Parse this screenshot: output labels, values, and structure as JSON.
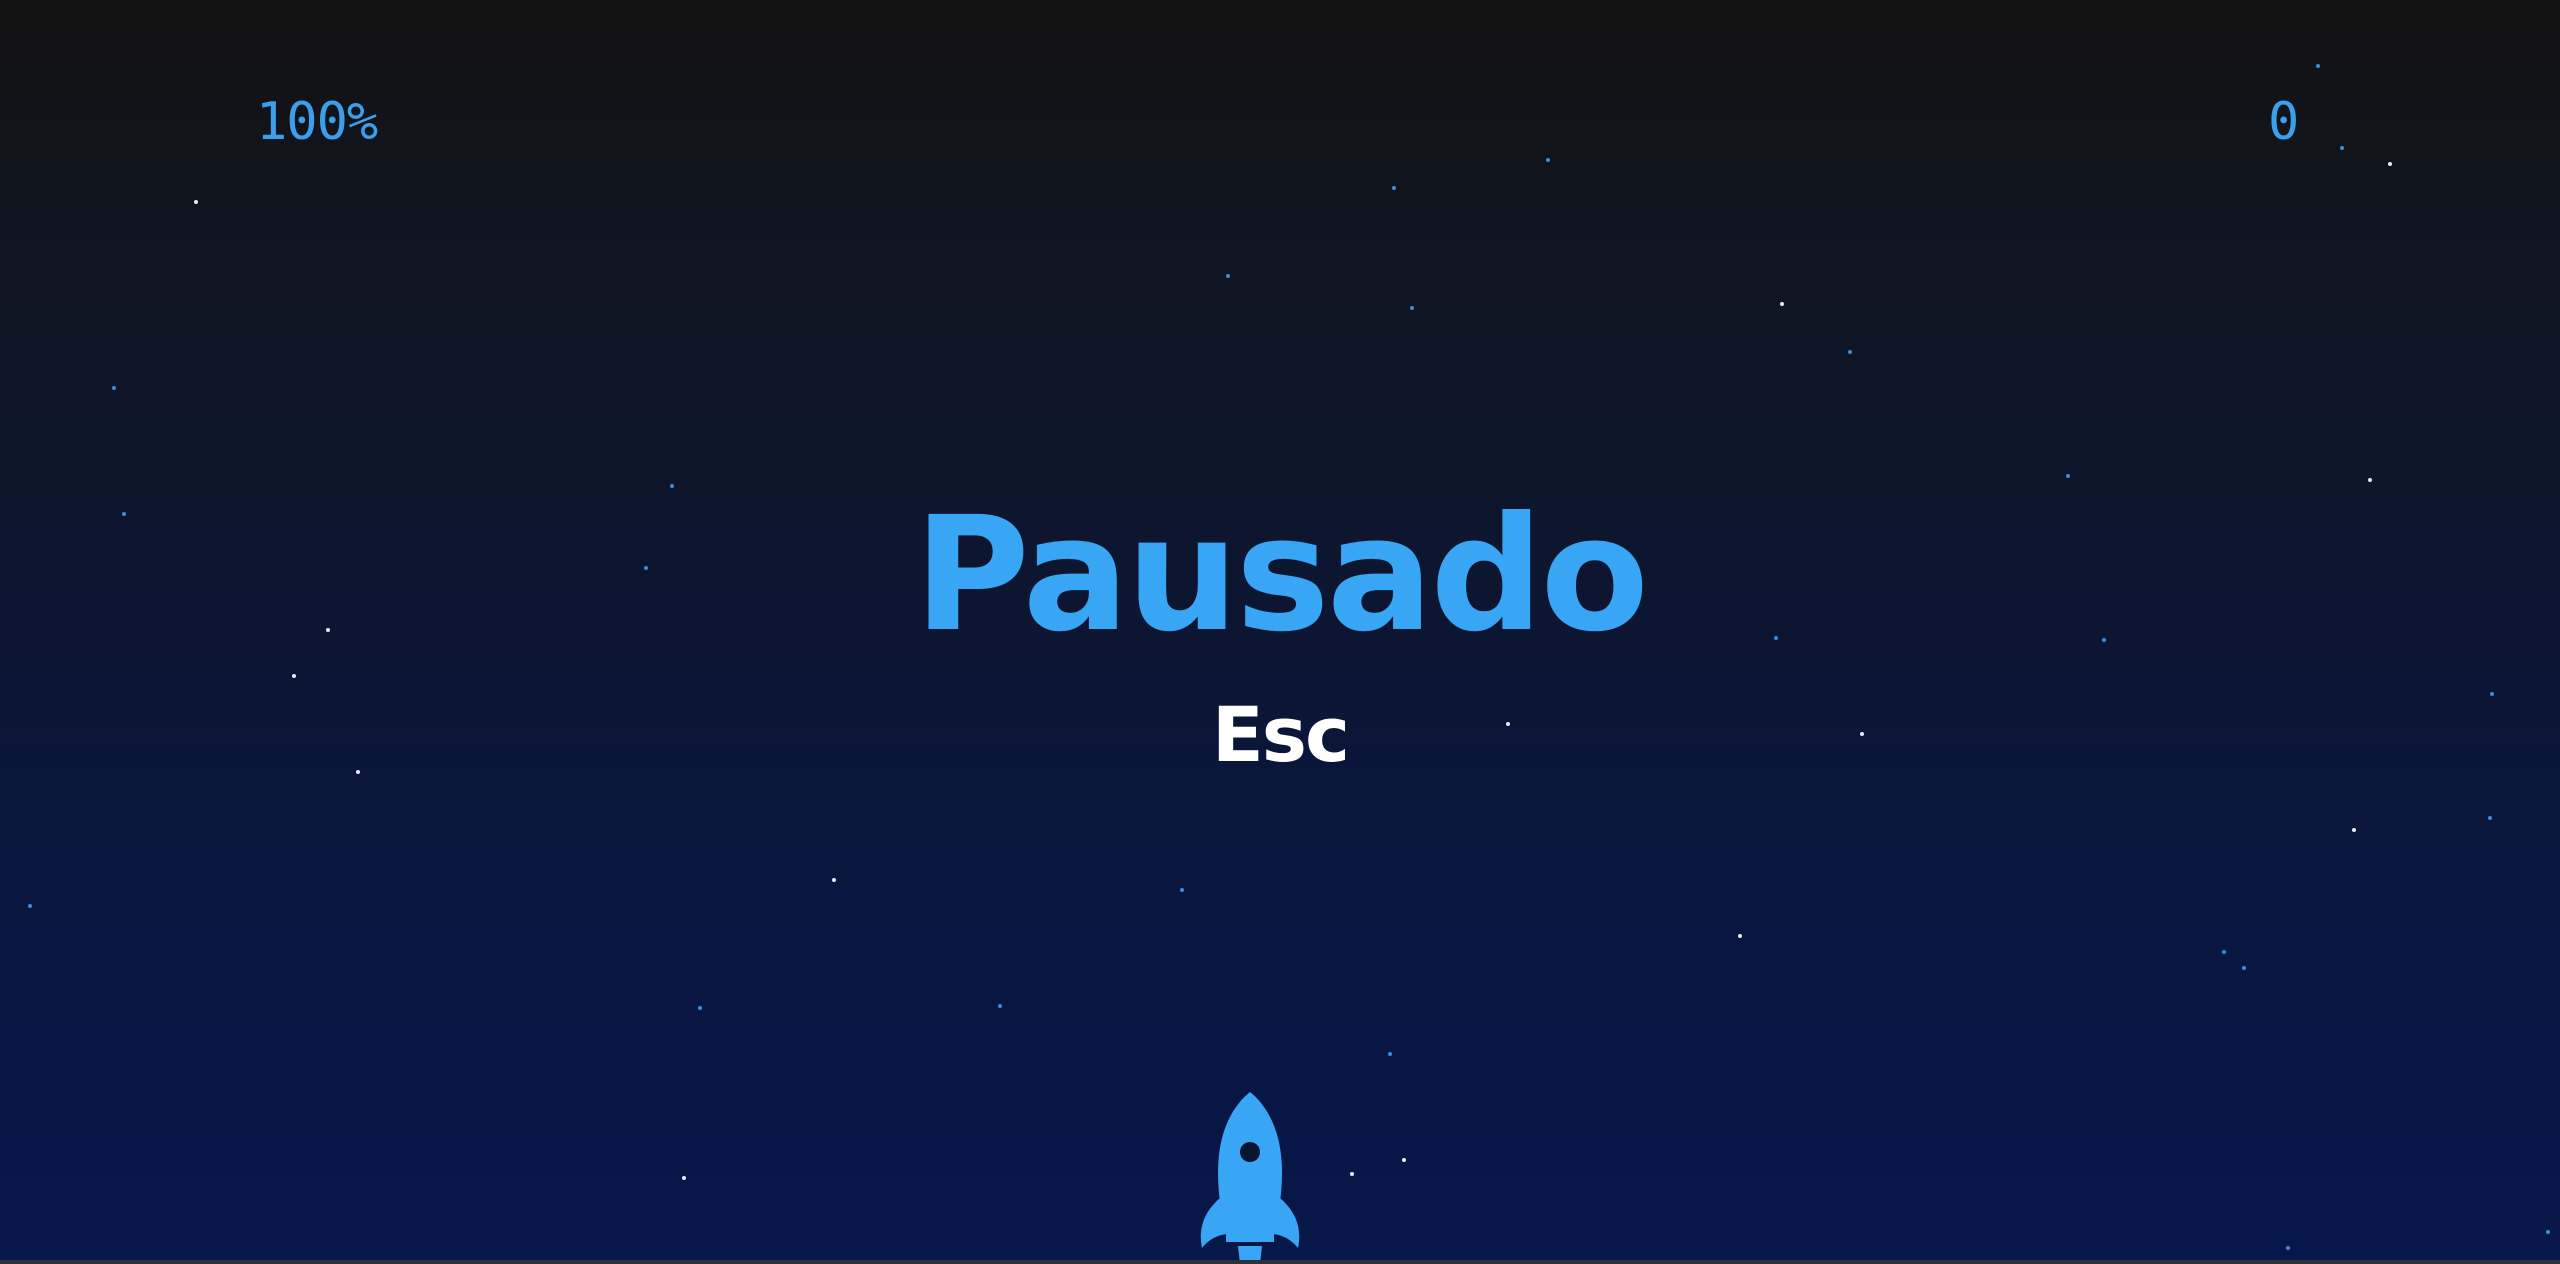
{
  "hud": {
    "progress_text": "100%",
    "score_text": "0"
  },
  "pause_overlay": {
    "title": "Pausado",
    "key_hint": "Esc"
  },
  "player": {
    "icon": "rocket-icon",
    "color": "#38a6f5"
  },
  "colors": {
    "accent": "#38a6f5",
    "text_white": "#ffffff",
    "background_top": "#121212",
    "background_bottom": "#071749",
    "star_blue": "#3b8de0",
    "star_white": "#e8ecf2"
  }
}
